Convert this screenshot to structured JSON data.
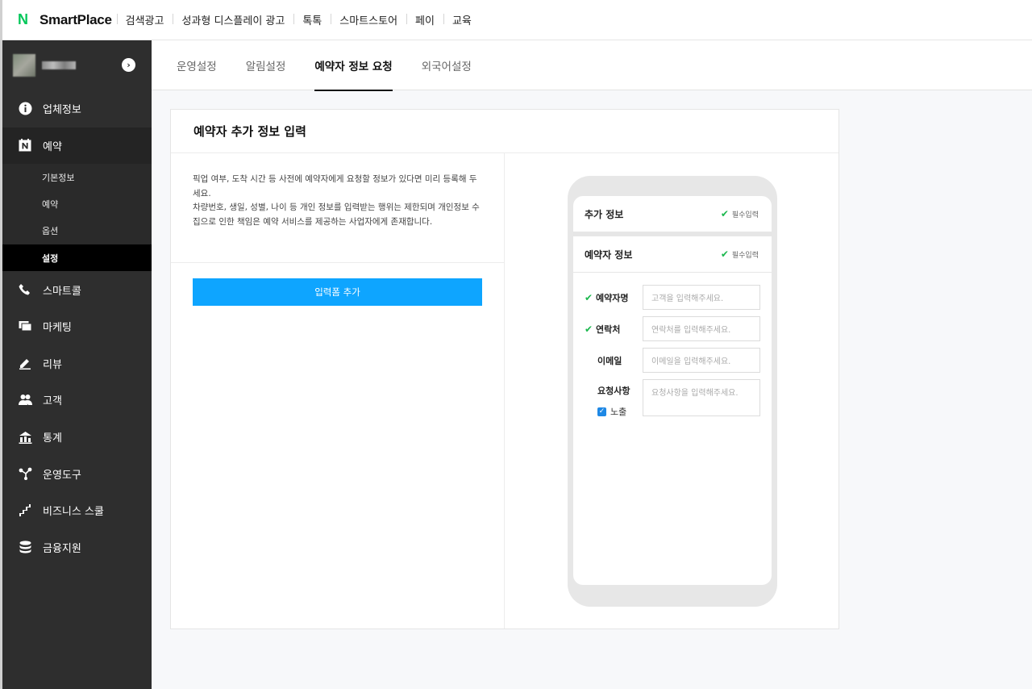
{
  "brand": {
    "logo_letter": "N",
    "name": "SmartPlace"
  },
  "topnav": [
    "검색광고",
    "성과형 디스플레이 광고",
    "톡톡",
    "스마트스토어",
    "페이",
    "교육"
  ],
  "sidebar": {
    "account_toggle_icon": "chevron-right-icon",
    "items": [
      {
        "label": "업체정보",
        "icon": "info-icon"
      },
      {
        "label": "예약",
        "icon": "naver-booking-icon",
        "active": true
      },
      {
        "label": "스마트콜",
        "icon": "phone-icon"
      },
      {
        "label": "마케팅",
        "icon": "marketing-icon"
      },
      {
        "label": "리뷰",
        "icon": "pencil-icon"
      },
      {
        "label": "고객",
        "icon": "users-icon"
      },
      {
        "label": "통계",
        "icon": "stats-icon"
      },
      {
        "label": "운영도구",
        "icon": "tools-icon"
      },
      {
        "label": "비즈니스 스쿨",
        "icon": "stairs-icon"
      },
      {
        "label": "금융지원",
        "icon": "coins-icon"
      }
    ],
    "subitems": [
      {
        "label": "기본정보"
      },
      {
        "label": "예약"
      },
      {
        "label": "옵션"
      },
      {
        "label": "설정",
        "active": true
      }
    ]
  },
  "tabs": [
    {
      "label": "운영설정"
    },
    {
      "label": "알림설정"
    },
    {
      "label": "예약자 정보 요청",
      "active": true
    },
    {
      "label": "외국어설정"
    }
  ],
  "panel": {
    "title": "예약자 추가 정보 입력",
    "desc_line1": "픽업 여부, 도착 시간 등 사전에 예약자에게 요청할 정보가 있다면 미리 등록해 두세요.",
    "desc_line2": "차량번호, 생일, 성별, 나이 등 개인 정보를 입력받는 행위는 제한되며 개인정보 수집으로 인한 책임은 예약 서비스를 제공하는 사업자에게 존재합니다.",
    "add_button": "입력폼 추가"
  },
  "preview": {
    "section1_title": "추가 정보",
    "section2_title": "예약자 정보",
    "required_label": "필수입력",
    "fields": [
      {
        "label": "예약자명",
        "placeholder": "고객을 입력해주세요.",
        "required": true
      },
      {
        "label": "연락처",
        "placeholder": "연락처를 입력해주세요.",
        "required": true
      },
      {
        "label": "이메일",
        "placeholder": "이메일을 입력해주세요.",
        "required": false
      },
      {
        "label": "요청사항",
        "placeholder": "요청사항을 입력해주세요.",
        "required": false
      }
    ],
    "expose_label": "노출",
    "expose_checked": true
  },
  "colors": {
    "accent": "#0ea5ff",
    "brand_green": "#03c75a",
    "sidebar_bg": "#2e2e2e",
    "check_green": "#1bb84e"
  }
}
